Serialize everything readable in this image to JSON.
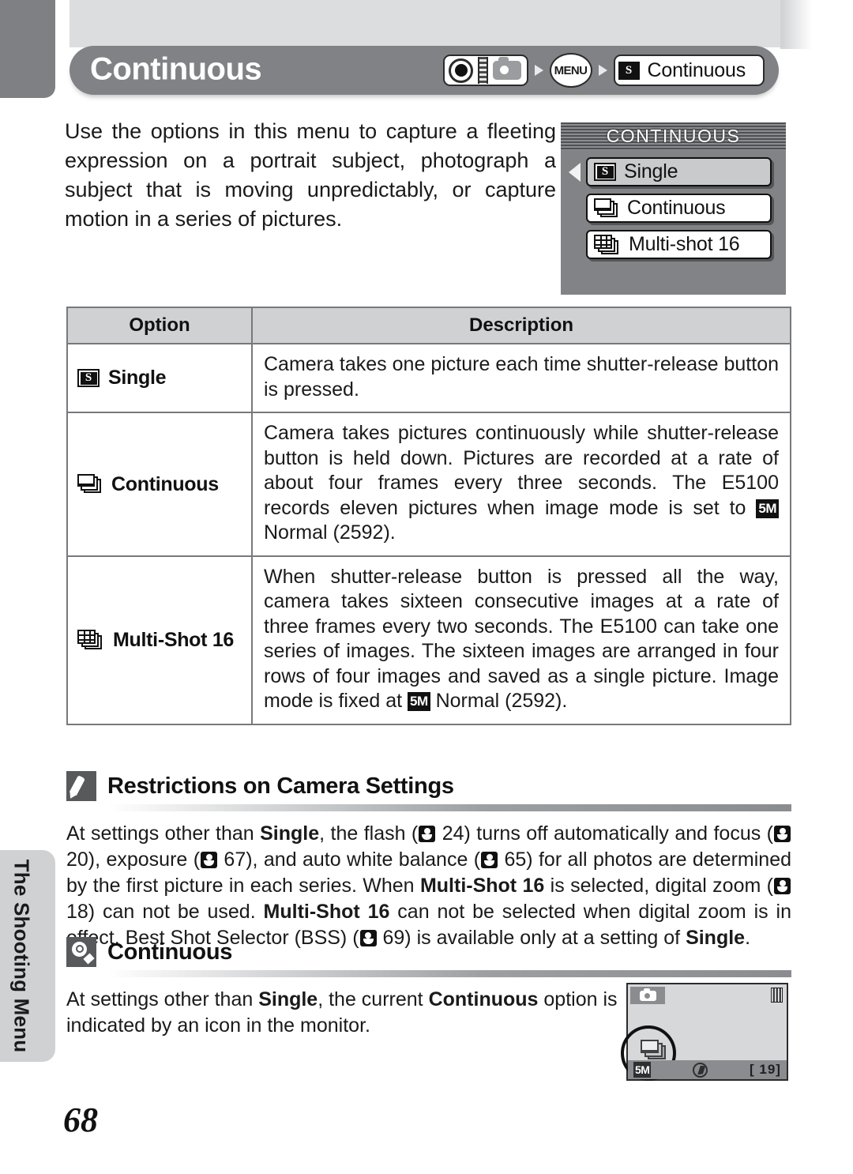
{
  "page": {
    "number": "68",
    "side_tab_label": "The Shooting Menu"
  },
  "header": {
    "title": "Continuous",
    "breadcrumb": {
      "mode_dial_icon": "mode-dial-camera-icon",
      "menu_button_label": "MENU",
      "option_badge": "S",
      "option_label": "Continuous"
    }
  },
  "intro": {
    "text": "Use the options in this menu to capture a fleeting expression on a portrait subject, photograph a subject that is moving unpredictably, or capture motion in a series of pictures."
  },
  "menu_screen": {
    "title": "CONTINUOUS",
    "items": [
      {
        "label": "Single",
        "icon": "single-icon",
        "selected": true
      },
      {
        "label": "Continuous",
        "icon": "continuous-icon",
        "selected": false
      },
      {
        "label": "Multi-shot 16",
        "icon": "multi-shot-icon",
        "selected": false
      }
    ]
  },
  "table": {
    "headers": [
      "Option",
      "Description"
    ],
    "rows": [
      {
        "icon": "single-icon",
        "option": "Single",
        "description_pre": "Camera takes one picture each time shutter-release button is pressed.",
        "badge": "",
        "description_post": ""
      },
      {
        "icon": "continuous-icon",
        "option": "Continuous",
        "description_pre": "Camera takes pictures continuously while shutter-release button is held down. Pictures are recorded at a rate of about four frames every three seconds. The E5100 records eleven pictures when image mode is set to ",
        "badge": "5M",
        "description_post": " Normal (2592)."
      },
      {
        "icon": "multi-shot-icon",
        "option": "Multi-Shot 16",
        "description_pre": "When shutter-release button is pressed all the way, camera takes sixteen consecutive images at a rate of three frames every two seconds. The E5100 can take one series of images. The sixteen images are arranged in four rows of four images and saved as a single picture. Image mode is fixed at ",
        "badge": "5M",
        "description_post": " Normal (2592)."
      }
    ]
  },
  "notes": [
    {
      "icon": "pencil-icon",
      "title": "Restrictions on Camera Settings",
      "segments": [
        {
          "t": "At settings other than "
        },
        {
          "t": "Single",
          "b": true
        },
        {
          "t": ", the flash ("
        },
        {
          "t": "",
          "kb": true
        },
        {
          "t": " 24) turns off automatically and focus ("
        },
        {
          "t": "",
          "kb": true
        },
        {
          "t": " 20), exposure ("
        },
        {
          "t": "",
          "kb": true
        },
        {
          "t": " 67), and auto white balance ("
        },
        {
          "t": "",
          "kb": true
        },
        {
          "t": " 65) for all photos are determined by the first picture in each series. When "
        },
        {
          "t": "Multi-Shot 16",
          "b": true
        },
        {
          "t": " is selected, digital zoom ("
        },
        {
          "t": "",
          "kb": true
        },
        {
          "t": " 18) can not be used. "
        },
        {
          "t": "Multi-Shot 16",
          "b": true
        },
        {
          "t": " can not be selected when digital zoom is in effect. Best Shot Selector (BSS) ("
        },
        {
          "t": "",
          "kb": true
        },
        {
          "t": " 69) is available only at a setting of "
        },
        {
          "t": "Single",
          "b": true
        },
        {
          "t": "."
        }
      ]
    },
    {
      "icon": "lightbulb-icon",
      "title": "Continuous",
      "segments": [
        {
          "t": "At settings other than "
        },
        {
          "t": "Single",
          "b": true
        },
        {
          "t": ", the current "
        },
        {
          "t": "Continuous",
          "b": true
        },
        {
          "t": " option is indicated by an icon in the monitor."
        }
      ]
    }
  ],
  "monitor": {
    "mode_icon": "camera-mode-icon",
    "battery_icon": "battery-icon",
    "highlighted_icon": "continuous-icon",
    "image_mode_badge": "5M",
    "flash_icon": "flash-off-icon",
    "shots_remaining": "[  19]"
  },
  "colors": {
    "title_bar": "#808285",
    "band": "#dcdddf",
    "menu_screen": "#818386",
    "rule": "#8a8c8f"
  }
}
